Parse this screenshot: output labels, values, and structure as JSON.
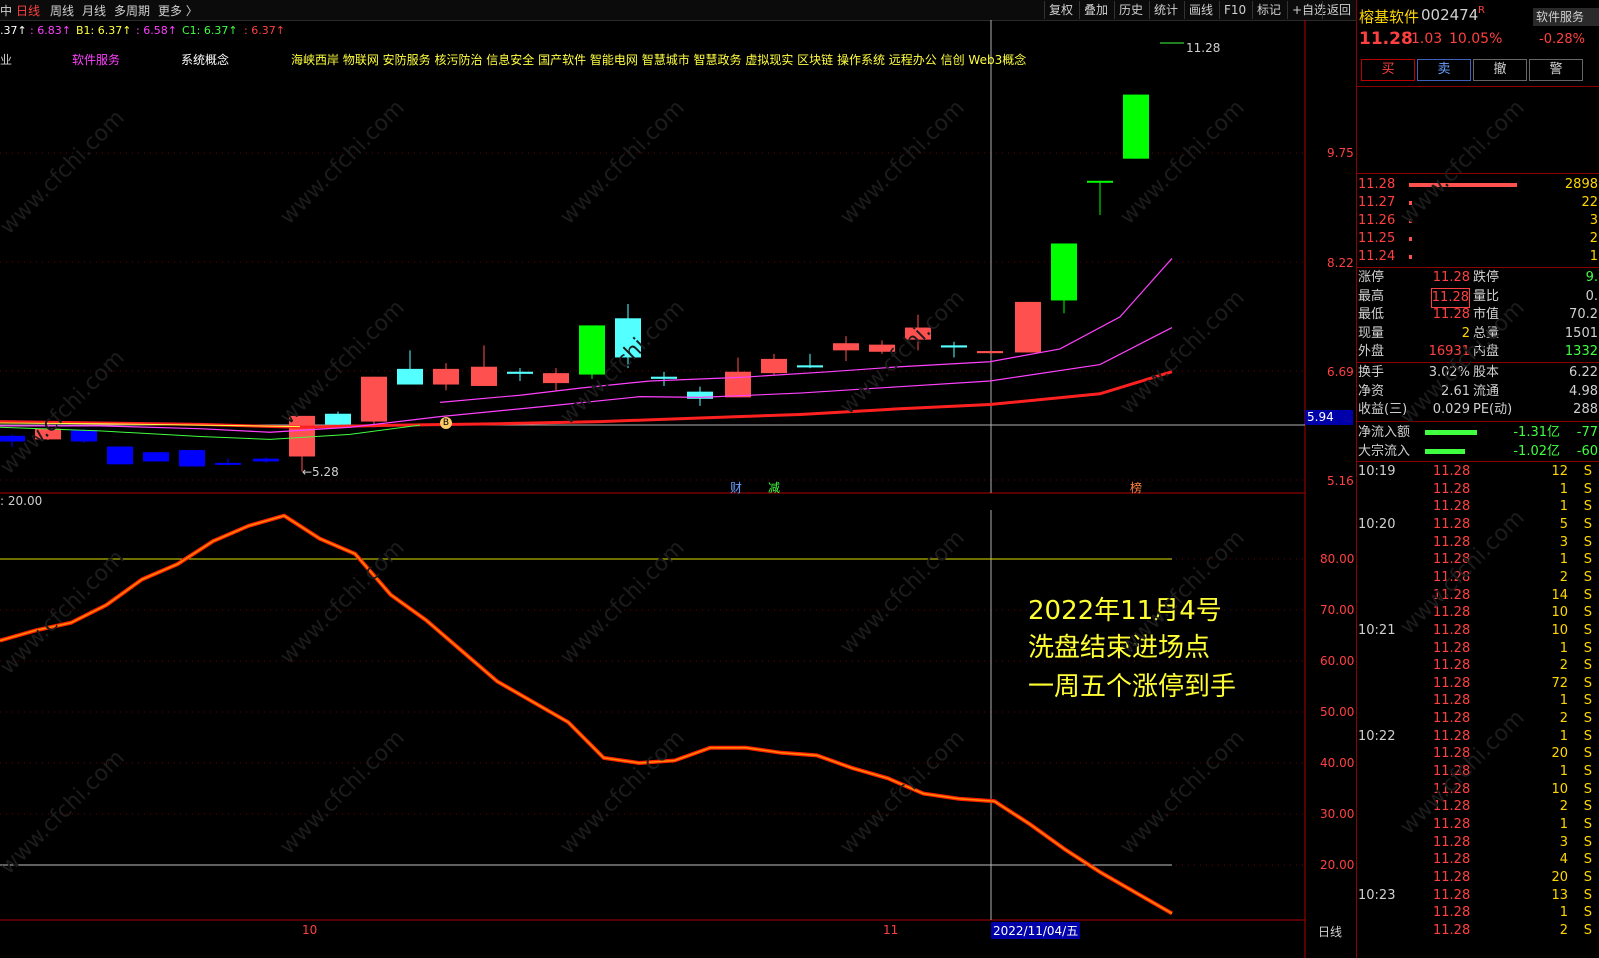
{
  "toolbar": {
    "left_tabs": [
      "中",
      "日线",
      "周线",
      "月线",
      "多周期",
      "更多 〉"
    ],
    "active_tab": "日线",
    "right_buttons": [
      "复权",
      "叠加",
      "历史",
      "统计",
      "画线",
      "F10",
      "标记",
      "+自选",
      "返回"
    ]
  },
  "indicator_legend": [
    {
      "text": ".37↑",
      "color": "#ffffff"
    },
    {
      "text": ": 6.83↑",
      "color": "#ff40ff"
    },
    {
      "text": "B1: 6.37↑",
      "color": "#ffff40"
    },
    {
      "text": ": 6.58↑",
      "color": "#ff40ff"
    },
    {
      "text": "C1: 6.37↑",
      "color": "#40ff40"
    },
    {
      "text": ": 6.37↑",
      "color": "#ff4040"
    }
  ],
  "concepts": {
    "industry": "业",
    "sector": "软件服务",
    "system": "系统概念",
    "tags": "海峡西岸 物联网 安防服务 核污防治 信息安全 国产软件 智能电网 智慧城市 智慧政务 虚拟现实 区块链 操作系统 远程办公 信创 Web3概念"
  },
  "main_chart": {
    "y_ticks": [
      "9.75",
      "8.22",
      "6.69",
      "5.16"
    ],
    "current_price_tag": "5.94",
    "high_label": "11.28",
    "low_label": "←5.28",
    "event_markers": [
      "财",
      "减",
      "榜"
    ],
    "buy_marker": "B"
  },
  "chart_data": {
    "type": "line",
    "title": "",
    "indicator_label": ": 20.00",
    "y_ticks": [
      "80.00",
      "70.00",
      "60.00",
      "50.00",
      "40.00",
      "30.00",
      "20.00"
    ],
    "xlabel": "",
    "ylabel": "",
    "ylim": [
      10,
      90
    ],
    "x_ticks": [
      "10",
      "11",
      "2022/11/04/五"
    ],
    "series": [
      {
        "values": [
          64,
          66,
          67.5,
          71,
          76,
          79,
          83.5,
          86.5,
          88.5,
          84,
          81,
          73,
          68,
          62,
          56,
          52,
          48,
          41,
          40,
          40.5,
          43,
          43,
          42,
          41.5,
          39,
          37,
          34,
          33,
          32.5,
          28,
          23,
          18.5,
          14.5,
          10.5
        ]
      }
    ],
    "reference_lines": [
      80,
      20
    ],
    "period_label": "日线"
  },
  "annotation": [
    "2022年11月4号",
    "洗盘结束进场点",
    "一周五个涨停到手"
  ],
  "stock": {
    "name": "榕基软件",
    "code": "002474",
    "flag": "R",
    "price": "11.28",
    "change": "1.03",
    "pct": "10.05%",
    "side_title": "软件服务",
    "side_pct": "-0.28%"
  },
  "trade_buttons": [
    "买",
    "卖",
    "撤",
    "警"
  ],
  "order_book": [
    {
      "price": "11.28",
      "vol": "2898"
    },
    {
      "price": "11.27",
      "vol": "22"
    },
    {
      "price": "11.26",
      "vol": "3"
    },
    {
      "price": "11.25",
      "vol": "2"
    },
    {
      "price": "11.24",
      "vol": "1"
    }
  ],
  "quote_stats": [
    {
      "l1": "涨停",
      "v1": "11.28",
      "l2": "跌停",
      "v2": "9."
    },
    {
      "l1": "最高",
      "v1": "11.28",
      "l2": "量比",
      "v2": "0."
    },
    {
      "l1": "最低",
      "v1": "11.28",
      "l2": "市值",
      "v2": "70.2"
    },
    {
      "l1": "现量",
      "v1": "2",
      "l2": "总量",
      "v2": "1501"
    },
    {
      "l1": "外盘",
      "v1": "16931",
      "l2": "内盘",
      "v2": "1332"
    }
  ],
  "fin_stats": [
    {
      "l1": "换手",
      "v1": "3.02%",
      "l2": "股本",
      "v2": "6.22"
    },
    {
      "l1": "净资",
      "v1": "2.61",
      "l2": "流通",
      "v2": "4.98"
    },
    {
      "l1": "收益(三)",
      "v1": "0.029",
      "l2": "PE(动)",
      "v2": "288"
    }
  ],
  "flows": [
    {
      "label": "净流入额",
      "value": "-1.31亿",
      "extra": "-77"
    },
    {
      "label": "大宗流入",
      "value": "-1.02亿",
      "extra": "-60"
    }
  ],
  "ticks": [
    {
      "time": "10:19",
      "price": "11.28",
      "vol": "12",
      "side": "S"
    },
    {
      "time": "",
      "price": "11.28",
      "vol": "1",
      "side": "S"
    },
    {
      "time": "",
      "price": "11.28",
      "vol": "1",
      "side": "S"
    },
    {
      "time": "10:20",
      "price": "11.28",
      "vol": "5",
      "side": "S"
    },
    {
      "time": "",
      "price": "11.28",
      "vol": "3",
      "side": "S"
    },
    {
      "time": "",
      "price": "11.28",
      "vol": "1",
      "side": "S"
    },
    {
      "time": "",
      "price": "11.28",
      "vol": "2",
      "side": "S"
    },
    {
      "time": "",
      "price": "11.28",
      "vol": "14",
      "side": "S"
    },
    {
      "time": "",
      "price": "11.28",
      "vol": "10",
      "side": "S"
    },
    {
      "time": "10:21",
      "price": "11.28",
      "vol": "10",
      "side": "S"
    },
    {
      "time": "",
      "price": "11.28",
      "vol": "1",
      "side": "S"
    },
    {
      "time": "",
      "price": "11.28",
      "vol": "2",
      "side": "S"
    },
    {
      "time": "",
      "price": "11.28",
      "vol": "72",
      "side": "S"
    },
    {
      "time": "",
      "price": "11.28",
      "vol": "1",
      "side": "S"
    },
    {
      "time": "",
      "price": "11.28",
      "vol": "2",
      "side": "S"
    },
    {
      "time": "10:22",
      "price": "11.28",
      "vol": "1",
      "side": "S"
    },
    {
      "time": "",
      "price": "11.28",
      "vol": "20",
      "side": "S"
    },
    {
      "time": "",
      "price": "11.28",
      "vol": "1",
      "side": "S"
    },
    {
      "time": "",
      "price": "11.28",
      "vol": "10",
      "side": "S"
    },
    {
      "time": "",
      "price": "11.28",
      "vol": "2",
      "side": "S"
    },
    {
      "time": "",
      "price": "11.28",
      "vol": "1",
      "side": "S"
    },
    {
      "time": "",
      "price": "11.28",
      "vol": "3",
      "side": "S"
    },
    {
      "time": "",
      "price": "11.28",
      "vol": "4",
      "side": "S"
    },
    {
      "time": "",
      "price": "11.28",
      "vol": "20",
      "side": "S"
    },
    {
      "time": "10:23",
      "price": "11.28",
      "vol": "13",
      "side": "S"
    },
    {
      "time": "",
      "price": "11.28",
      "vol": "1",
      "side": "S"
    },
    {
      "time": "",
      "price": "11.28",
      "vol": "2",
      "side": "S"
    }
  ],
  "watermark": "www.cfchi.com",
  "colors": {
    "up": "#ff5050",
    "down_cyan": "#54ffff",
    "limit_up": "#00ff00",
    "down_blue": "#0000ff",
    "accent": "#ff4040"
  }
}
